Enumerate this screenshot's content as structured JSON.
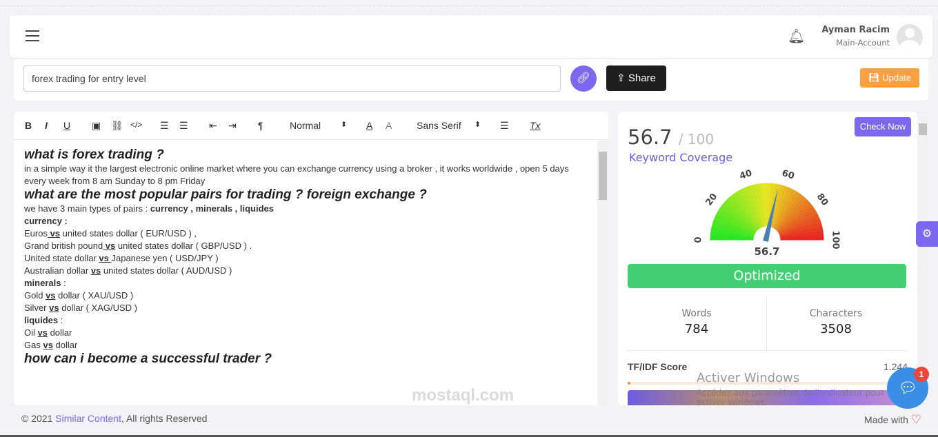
{
  "header": {
    "user_name": "Ayman Racim",
    "account": "Main-Account"
  },
  "keyword_bar": {
    "value": "forex trading for entry level",
    "share": "Share",
    "update": "Update"
  },
  "toolbar": {
    "bold": "B",
    "italic": "I",
    "underline": "U",
    "header_select": "Normal",
    "font_select": "Sans Serif",
    "clear": "Tx",
    "pilcrow": "¶"
  },
  "content": {
    "h1": "what is forex trading ?",
    "p1": "in a simple way it the largest electronic online market where you can exchange currency using a broker , it works worldwide , open 5 days every week from 8 am Sunday to 8 pm Friday",
    "h2": "what are the most popular pairs for trading ?  foreign exchange ?",
    "p2a": "we have 3 main types of pairs : ",
    "p2b": "currency , minerals , liquides",
    "currency": "currency :",
    "lines": [
      {
        "a": "Euros",
        "vs": " vs",
        "b": " united states dollar ( EUR/USD ) ,"
      },
      {
        "a": "Grand british pound",
        "vs": " vs",
        "b": " united states dollar ( GBP/USD ) ."
      },
      {
        "a": "United state dollar ",
        "vs": "vs ",
        "b": " Japanese yen ( USD/JPY )"
      },
      {
        "a": "Australian dollar ",
        "vs": "vs",
        "b": " united states dollar ( AUD/USD )"
      }
    ],
    "minerals": "minerals",
    "mlines": [
      {
        "a": "Gold ",
        "vs": "vs",
        "b": " dollar ( XAU/USD )"
      },
      {
        "a": "Silver ",
        "vs": "vs",
        "b": " dollar ( XAG/USD )"
      }
    ],
    "liquides": "liquides",
    "llines": [
      {
        "a": "Oil ",
        "vs": "vs",
        "b": " dollar"
      },
      {
        "a": "Gas ",
        "vs": "vs",
        "b": " dollar"
      }
    ],
    "colon": " :",
    "h3": "how can i become a successful trader ?"
  },
  "side": {
    "score": "56.7",
    "out_of": "/ 100",
    "score_label": "Keyword Coverage",
    "check_now": "Check Now",
    "gauge": {
      "value": 56.7,
      "min": 0,
      "max": 100,
      "ticks": [
        "0",
        "20",
        "40",
        "60",
        "80",
        "100"
      ],
      "label": "56.7"
    },
    "status": "Optimized",
    "words_label": "Words",
    "words": "784",
    "chars_label": "Characters",
    "chars": "3508",
    "tfidf_label": "TF/IDF Score",
    "tfidf": "1.244",
    "tfidf_progress": 0.01
  },
  "footer": {
    "copy": "© 2021 ",
    "brand": "Similar Content",
    "rights": ", All rights Reserved",
    "made": "Made with"
  },
  "chat": {
    "badge": "1"
  },
  "windows": {
    "title": "Activer Windows",
    "sub": "Accédez aux paramètres de l'ordinateur pour activer Windows."
  },
  "watermark": "mostaql.com",
  "colors": {
    "accent": "#7b68ee",
    "success": "#45cf74",
    "update": "#ffa040"
  }
}
